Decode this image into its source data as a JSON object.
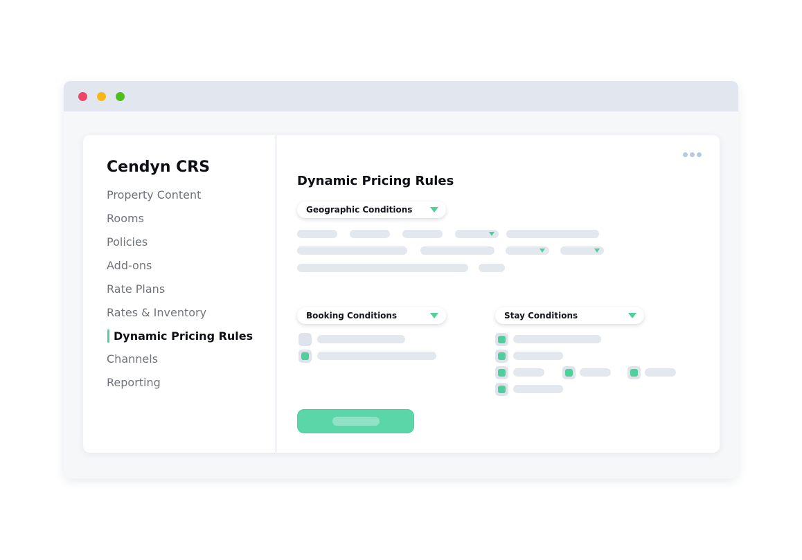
{
  "window": {
    "controls": [
      "close-dot",
      "minimize-dot",
      "maximize-dot"
    ],
    "colors": {
      "close": "#ef4566",
      "minimize": "#f7b718",
      "maximize": "#4fbf1f"
    }
  },
  "sidebar": {
    "brand": "Cendyn CRS",
    "items": [
      {
        "label": "Property Content"
      },
      {
        "label": "Rooms"
      },
      {
        "label": "Policies"
      },
      {
        "label": "Add-ons"
      },
      {
        "label": "Rate Plans"
      },
      {
        "label": "Rates & Inventory"
      },
      {
        "label": "Dynamic Pricing Rules",
        "active": true
      },
      {
        "label": "Channels"
      },
      {
        "label": "Reporting"
      }
    ]
  },
  "main": {
    "title": "Dynamic Pricing Rules",
    "more_icon": "more-horizontal-icon",
    "sections": {
      "geographic": {
        "label": "Geographic Conditions"
      },
      "booking": {
        "label": "Booking Conditions",
        "checkbox_states": [
          false,
          true
        ]
      },
      "stay": {
        "label": "Stay Conditions",
        "checkbox_states": [
          true,
          true,
          true,
          true,
          true,
          true
        ]
      }
    }
  },
  "colors": {
    "accent": "#4fcf9b",
    "placeholder": "#e3e7ee",
    "text": "#0d0f14",
    "muted": "#6f7379"
  }
}
